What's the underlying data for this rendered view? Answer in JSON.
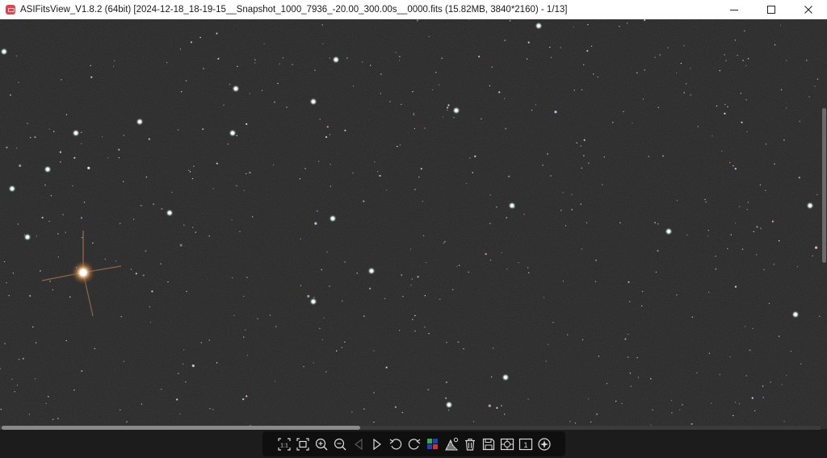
{
  "window": {
    "title": "ASIFitsView_V1.8.2 (64bit) [2024-12-18_18-19-15__Snapshot_1000_7936_-20.00_300.00s__0000.fits (15.82MB, 3840*2160) - 1/13]",
    "controls": [
      "minimize-icon",
      "maximize-icon",
      "close-icon"
    ]
  },
  "image": {
    "subject": "star-field",
    "background_color": "#262626"
  },
  "toolbar": {
    "tools": [
      "fit-1to1-icon",
      "fit-window-icon",
      "zoom-in-icon",
      "zoom-out-icon",
      "previous-icon",
      "next-icon",
      "rotate-left-icon",
      "rotate-right-icon",
      "color-channels-icon",
      "histogram-icon",
      "delete-icon",
      "save-icon",
      "stretch-icon",
      "single-frame-icon",
      "star-detect-icon"
    ],
    "accent_color": "#d9d9d9",
    "disabled_color": "#5a5a5a"
  }
}
